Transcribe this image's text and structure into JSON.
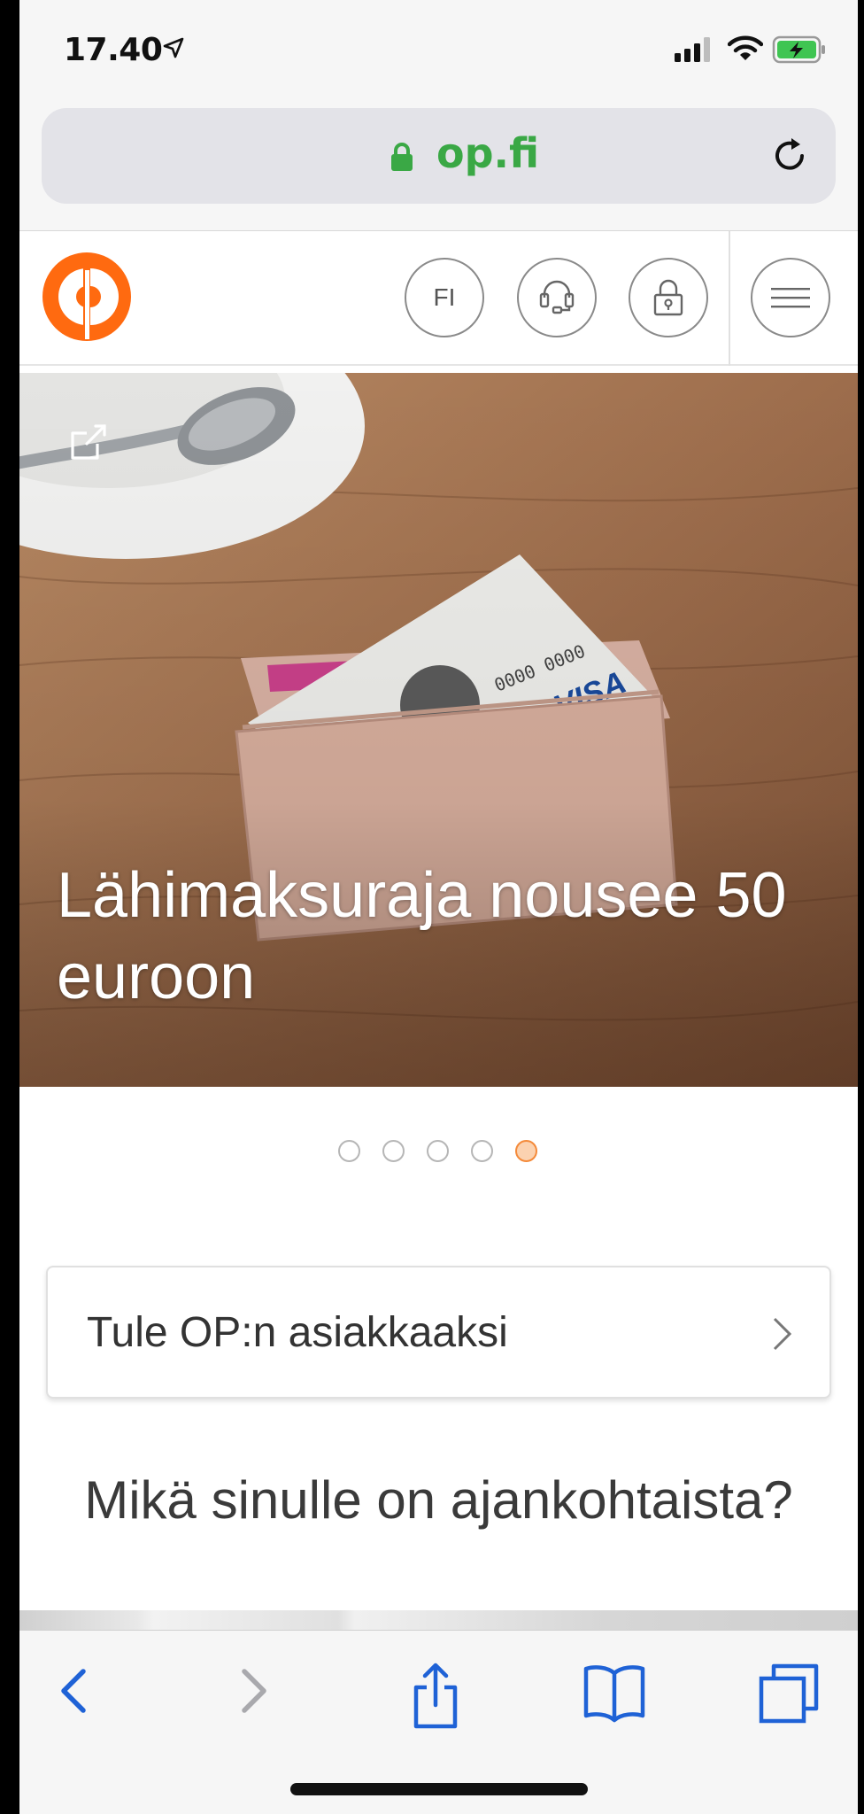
{
  "status_bar": {
    "time": "17.40"
  },
  "browser": {
    "url": "op.fi"
  },
  "header": {
    "language_label": "FI"
  },
  "hero": {
    "title": "Lähimaksuraja nousee 50 euroon",
    "slide_count": 5,
    "active_slide": 5
  },
  "cta": {
    "label": "Tule OP:n asiakkaaksi"
  },
  "section": {
    "heading": "Mikä sinulle on ajankohtaista?"
  },
  "colors": {
    "brand_orange": "#ff6a10",
    "url_green": "#3aa845",
    "ios_blue": "#1f62d6"
  }
}
